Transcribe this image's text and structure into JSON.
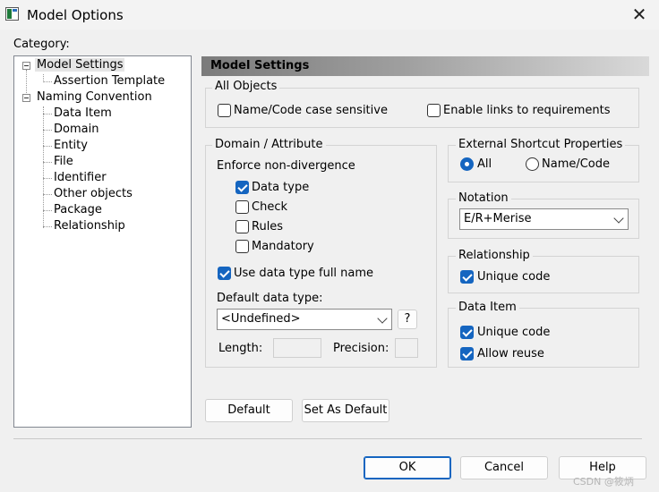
{
  "window": {
    "title": "Model Options",
    "icon": "app-model-icon",
    "close_icon": "close-icon"
  },
  "category_label": "Category:",
  "tree": {
    "model_settings": "Model Settings",
    "assertion_template": "Assertion Template",
    "naming_convention": "Naming Convention",
    "children": [
      "Data Item",
      "Domain",
      "Entity",
      "File",
      "Identifier",
      "Other objects",
      "Package",
      "Relationship"
    ]
  },
  "panel_title": "Model Settings",
  "all_objects": {
    "title": "All Objects",
    "name_code_case": {
      "label": "Name/Code case sensitive",
      "checked": false
    },
    "enable_links": {
      "label": "Enable links to requirements",
      "checked": false
    }
  },
  "domain_attribute": {
    "title": "Domain / Attribute",
    "enforce_label": "Enforce non-divergence",
    "data_type": {
      "label": "Data type",
      "checked": true
    },
    "check": {
      "label": "Check",
      "checked": false
    },
    "rules": {
      "label": "Rules",
      "checked": false
    },
    "mandatory": {
      "label": "Mandatory",
      "checked": false
    },
    "use_full_name": {
      "label": "Use data type full name",
      "checked": true
    },
    "default_type_label": "Default data type:",
    "default_type_value": "<Undefined>",
    "help_button": "?",
    "length_label": "Length:",
    "length_value": "",
    "precision_label": "Precision:",
    "precision_value": ""
  },
  "external_shortcut": {
    "title": "External Shortcut Properties",
    "all": "All",
    "name_code": "Name/Code",
    "selected": "All"
  },
  "notation": {
    "title": "Notation",
    "value": "E/R+Merise"
  },
  "relationship": {
    "title": "Relationship",
    "unique_code": {
      "label": "Unique code",
      "checked": true
    }
  },
  "data_item": {
    "title": "Data Item",
    "unique_code": {
      "label": "Unique code",
      "checked": true
    },
    "allow_reuse": {
      "label": "Allow reuse",
      "checked": true
    }
  },
  "buttons": {
    "default": "Default",
    "set_as_default": "Set As Default",
    "ok": "OK",
    "cancel": "Cancel",
    "help": "Help"
  },
  "watermark": "CSDN @筱炳",
  "colors": {
    "accent": "#1565c0",
    "header_dark": "#7b7b7b",
    "header_light": "#d9d9d9"
  }
}
